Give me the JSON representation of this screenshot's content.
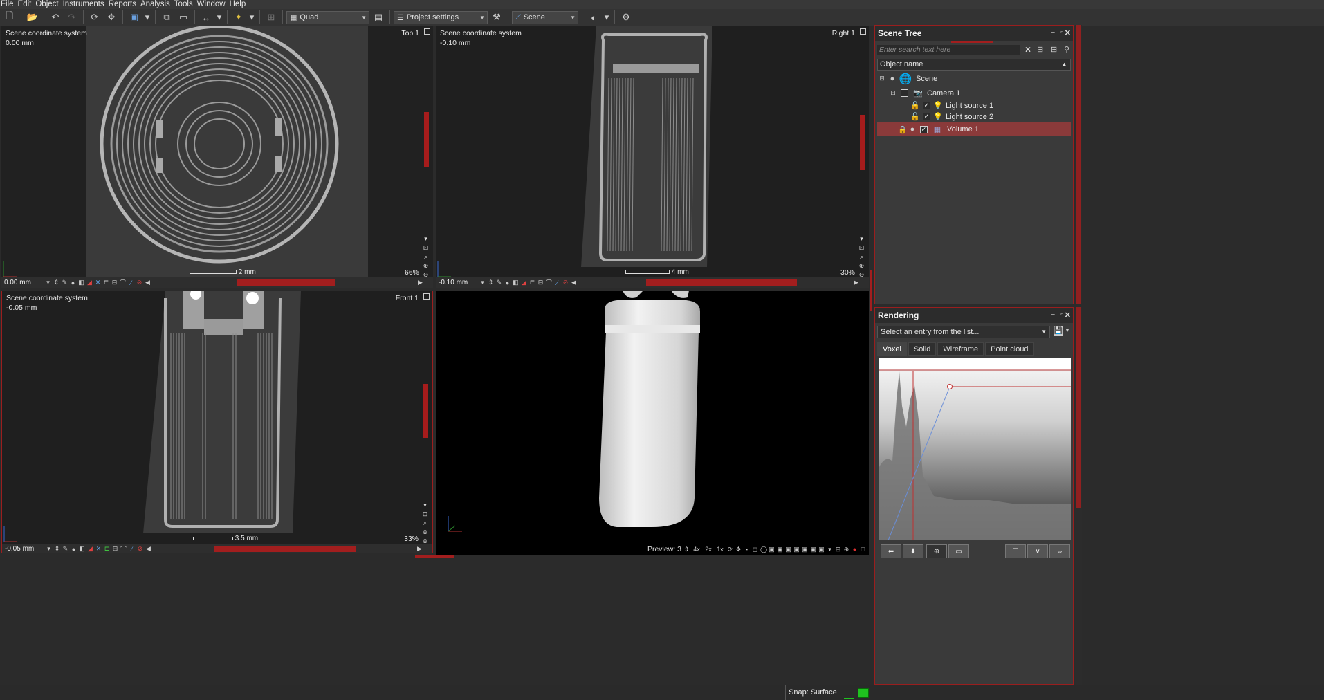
{
  "menu": [
    "File",
    "Edit",
    "Object",
    "Instruments",
    "Reports",
    "Analysis",
    "Tools",
    "Window",
    "Help"
  ],
  "toolbar": {
    "layout_combo": "Quad",
    "settings_combo": "Project settings",
    "scene_combo": "Scene"
  },
  "viewports": {
    "top": {
      "coord": "Scene coordinate system",
      "value": "0.00 mm",
      "name": "Top 1",
      "zoom": "66%",
      "scale": "2 mm",
      "field": "0.00 mm"
    },
    "right": {
      "coord": "Scene coordinate system",
      "value": "-0.10 mm",
      "name": "Right 1",
      "zoom": "30%",
      "scale": "4 mm",
      "field": "-0.10 mm"
    },
    "front": {
      "coord": "Scene coordinate system",
      "value": "-0.05 mm",
      "name": "Front 1",
      "zoom": "33%",
      "scale": "3.5 mm",
      "field": "-0.05 mm"
    },
    "view3d": {
      "preview_label": "Preview: 3",
      "zooms": [
        "4x",
        "2x",
        "1x"
      ]
    }
  },
  "scene_tree": {
    "title": "Scene Tree",
    "search_placeholder": "Enter search text here",
    "column": "Object name",
    "items": [
      {
        "label": "Scene",
        "icon": "globe-icon"
      },
      {
        "label": "Camera 1",
        "icon": "camera-icon"
      },
      {
        "label": "Light source 1",
        "icon": "bulb-icon"
      },
      {
        "label": "Light source 2",
        "icon": "bulb-icon"
      },
      {
        "label": "Volume 1",
        "icon": "volume-icon",
        "selected": true
      }
    ]
  },
  "rendering": {
    "title": "Rendering",
    "select_placeholder": "Select an entry from the list...",
    "tabs": [
      "Voxel",
      "Solid",
      "Wireframe",
      "Point cloud"
    ],
    "active_tab": "Voxel"
  },
  "status": {
    "snap": "Snap: Surface"
  },
  "colors": {
    "accent_red": "#a21e1e",
    "selected_row": "#8a3a3a",
    "status_green": "#1fc21f"
  }
}
